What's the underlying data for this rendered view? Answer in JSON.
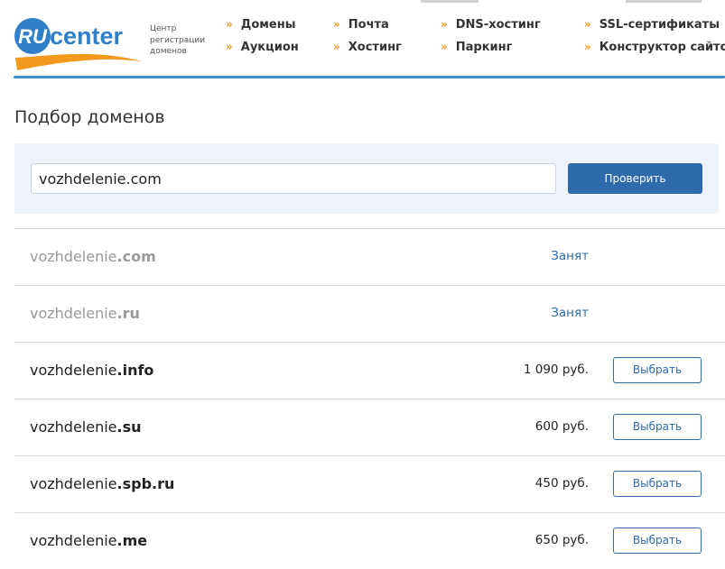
{
  "header": {
    "logo_text": "RU center",
    "tagline": [
      "Центр",
      "регистрации",
      "доменов"
    ],
    "nav": [
      {
        "label": "Домены"
      },
      {
        "label": "Почта"
      },
      {
        "label": "DNS-хостинг"
      },
      {
        "label": "SSL-сертификаты"
      },
      {
        "label": "Аукцион"
      },
      {
        "label": "Хостинг"
      },
      {
        "label": "Паркинг"
      },
      {
        "label": "Конструктор сайтов"
      }
    ],
    "nav_arrow": "»"
  },
  "page": {
    "title": "Подбор доменов"
  },
  "search": {
    "value": "vozhdelenie.com",
    "button_label": "Проверить"
  },
  "results": [
    {
      "name": "vozhdelenie",
      "tld": ".com",
      "status": "Занят",
      "taken": true
    },
    {
      "name": "vozhdelenie",
      "tld": ".ru",
      "status": "Занят",
      "taken": true
    },
    {
      "name": "vozhdelenie",
      "tld": ".info",
      "status": "1 090 руб.",
      "taken": false,
      "action": "Выбрать"
    },
    {
      "name": "vozhdelenie",
      "tld": ".su",
      "status": "600 руб.",
      "taken": false,
      "action": "Выбрать"
    },
    {
      "name": "vozhdelenie",
      "tld": ".spb.ru",
      "status": "450 руб.",
      "taken": false,
      "action": "Выбрать"
    },
    {
      "name": "vozhdelenie",
      "tld": ".me",
      "status": "650 руб.",
      "taken": false,
      "action": "Выбрать"
    }
  ],
  "colors": {
    "accent_blue": "#2f6aac",
    "nav_arrow": "#f29a1e",
    "header_rule": "#3b8fd0",
    "panel_bg": "#eef3f9"
  }
}
